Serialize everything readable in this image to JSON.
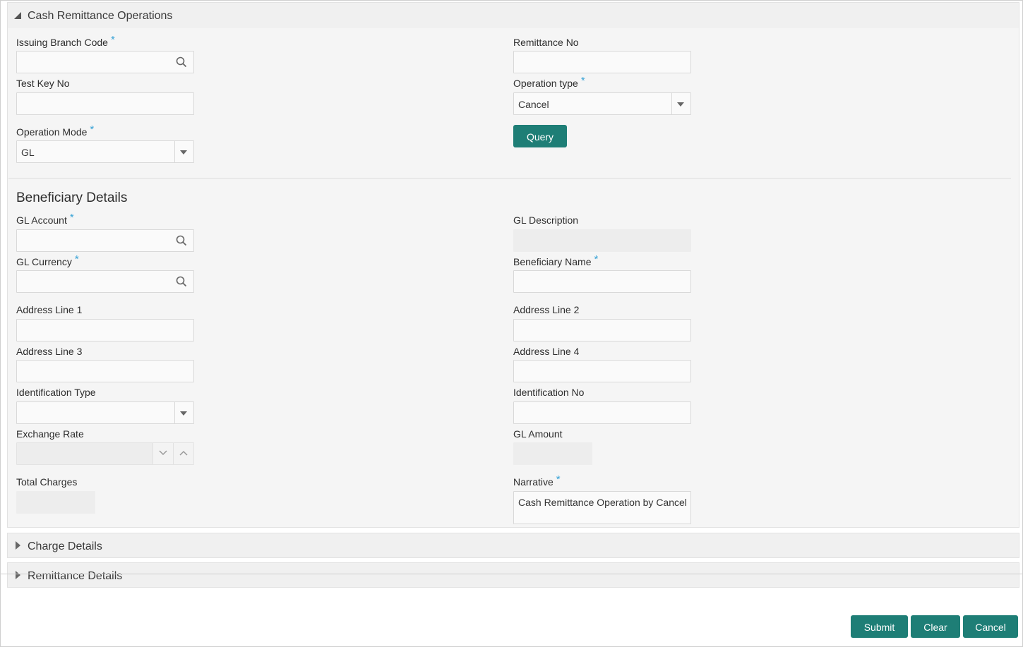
{
  "section_main": {
    "title": "Cash Remittance Operations"
  },
  "fields": {
    "issuing_branch_code": {
      "label": "Issuing Branch Code",
      "value": ""
    },
    "remittance_no": {
      "label": "Remittance No",
      "value": ""
    },
    "test_key_no": {
      "label": "Test Key No",
      "value": ""
    },
    "operation_type": {
      "label": "Operation type",
      "value": "Cancel"
    },
    "operation_mode": {
      "label": "Operation Mode",
      "value": "GL"
    }
  },
  "query_button": {
    "label": "Query"
  },
  "beneficiary": {
    "title": "Beneficiary Details",
    "gl_account": {
      "label": "GL Account",
      "value": ""
    },
    "gl_description": {
      "label": "GL Description",
      "value": ""
    },
    "gl_currency": {
      "label": "GL Currency",
      "value": ""
    },
    "beneficiary_name": {
      "label": "Beneficiary Name",
      "value": ""
    },
    "address_line_1": {
      "label": "Address Line 1",
      "value": ""
    },
    "address_line_2": {
      "label": "Address Line 2",
      "value": ""
    },
    "address_line_3": {
      "label": "Address Line 3",
      "value": ""
    },
    "address_line_4": {
      "label": "Address Line 4",
      "value": ""
    },
    "identification_type": {
      "label": "Identification Type",
      "value": ""
    },
    "identification_no": {
      "label": "Identification No",
      "value": ""
    },
    "exchange_rate": {
      "label": "Exchange Rate",
      "value": ""
    },
    "gl_amount": {
      "label": "GL Amount",
      "value": ""
    },
    "total_charges": {
      "label": "Total Charges",
      "value": ""
    },
    "narrative": {
      "label": "Narrative",
      "value": "Cash Remittance Operation by Cancel"
    }
  },
  "section_charge": {
    "title": "Charge Details"
  },
  "section_remittance": {
    "title": "Remittance Details"
  },
  "footer": {
    "submit": "Submit",
    "clear": "Clear",
    "cancel": "Cancel"
  },
  "required_marker": "*",
  "colors": {
    "accent": "#1e7e76",
    "required": "#3aa3d6"
  },
  "icons": {
    "search": "search-icon",
    "dropdown": "chevron-down-icon",
    "spinner_down": "chevron-down-icon",
    "spinner_up": "chevron-up-icon"
  }
}
